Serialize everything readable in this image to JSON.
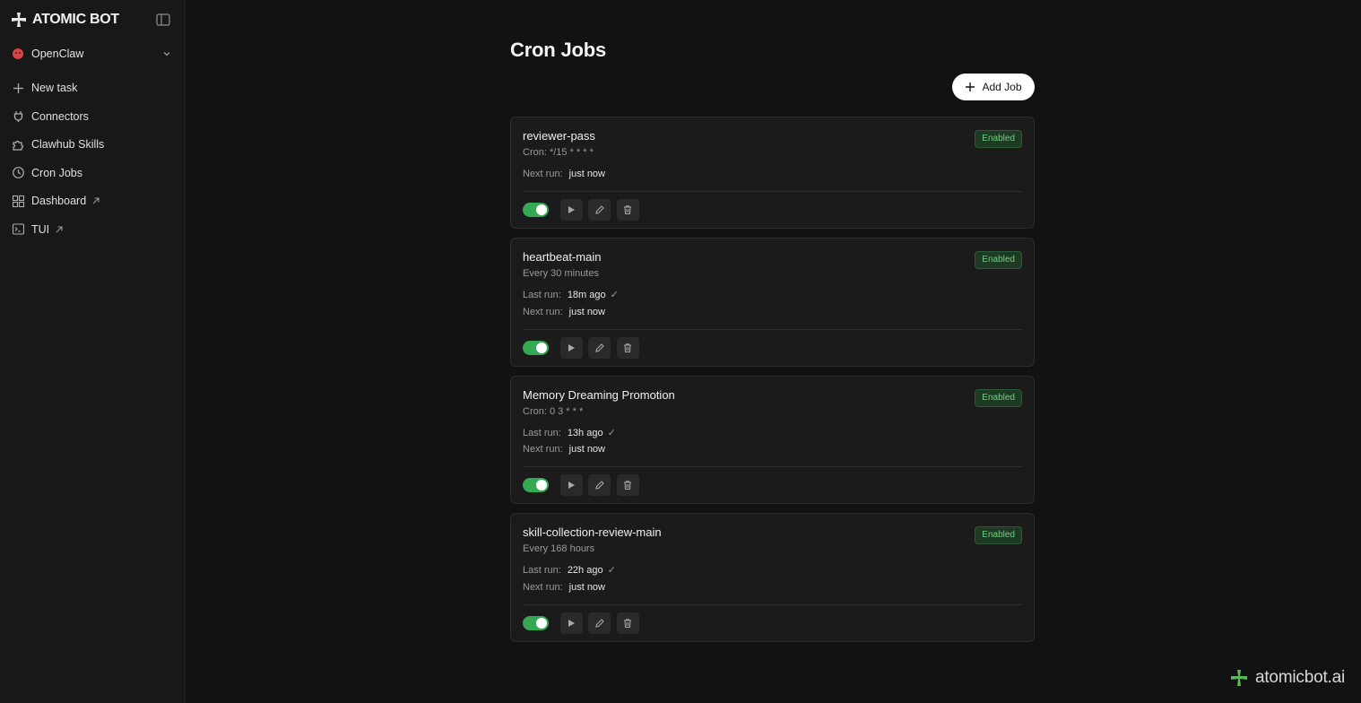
{
  "brand": {
    "name": "ATOMIC BOT"
  },
  "workspace": {
    "name": "OpenClaw"
  },
  "nav": [
    {
      "label": "New task",
      "icon": "plus-icon",
      "external": false
    },
    {
      "label": "Connectors",
      "icon": "plug-icon",
      "external": false
    },
    {
      "label": "Clawhub Skills",
      "icon": "puzzle-icon",
      "external": false
    },
    {
      "label": "Cron Jobs",
      "icon": "clock-icon",
      "external": false
    },
    {
      "label": "Dashboard",
      "icon": "grid-icon",
      "external": true
    },
    {
      "label": "TUI",
      "icon": "terminal-icon",
      "external": true
    }
  ],
  "page": {
    "title": "Cron Jobs",
    "add_job_label": "Add Job"
  },
  "run_labels": {
    "last": "Last run:",
    "next": "Next run:"
  },
  "jobs": [
    {
      "name": "reviewer-pass",
      "schedule": "Cron: */15 * * * *",
      "status": "Enabled",
      "last_run": null,
      "last_ok": false,
      "next_run": "just now",
      "enabled": true
    },
    {
      "name": "heartbeat-main",
      "schedule": "Every 30 minutes",
      "status": "Enabled",
      "last_run": "18m ago",
      "last_ok": true,
      "next_run": "just now",
      "enabled": true
    },
    {
      "name": "Memory Dreaming Promotion",
      "schedule": "Cron: 0 3 * * *",
      "status": "Enabled",
      "last_run": "13h ago",
      "last_ok": true,
      "next_run": "just now",
      "enabled": true
    },
    {
      "name": "skill-collection-review-main",
      "schedule": "Every 168 hours",
      "status": "Enabled",
      "last_run": "22h ago",
      "last_ok": true,
      "next_run": "just now",
      "enabled": true
    }
  ],
  "check_glyph": "✓",
  "footer": {
    "text": "atomicbot.ai"
  },
  "colors": {
    "accent_green": "#34a853",
    "badge_text": "#6fcf7f",
    "workspace_logo": "#d64545",
    "brand_logo": "#e8e8e8",
    "footer_logo": "#5cb85c"
  }
}
